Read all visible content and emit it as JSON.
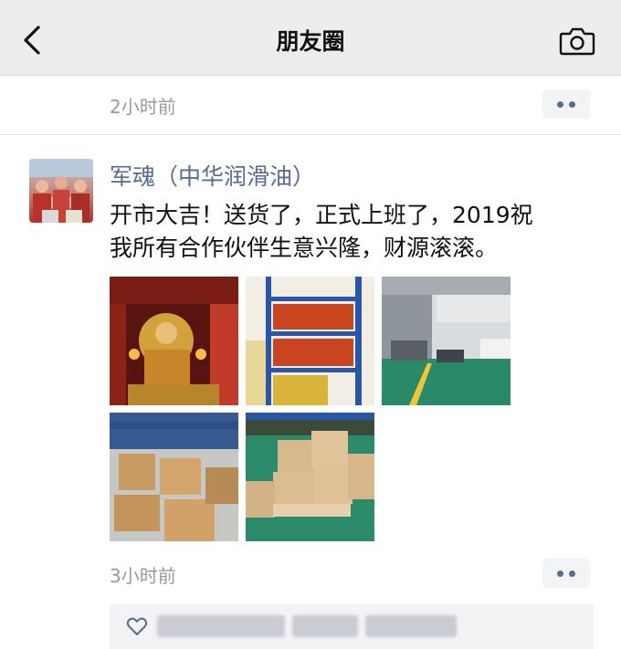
{
  "nav": {
    "title": "朋友圈",
    "back_icon": "chevron-left-icon",
    "camera_icon": "camera-icon"
  },
  "prev_post": {
    "time": "2小时前"
  },
  "post": {
    "username": "军魂（中华润滑油）",
    "text": "开市大吉！送货了，正式上班了，2019祝\n我所有合作伙伴生意兴隆，财源滚滚。",
    "photos": [
      {
        "desc": "shrine-photo"
      },
      {
        "desc": "oil-shelf-photo"
      },
      {
        "desc": "garage-photo"
      },
      {
        "desc": "warehouse-boxes-photo"
      },
      {
        "desc": "stacked-boxes-photo"
      }
    ],
    "time": "3小时前",
    "like_icon": "heart-icon"
  },
  "colors": {
    "link": "#576b95",
    "nav_bg": "#ededed",
    "meta": "#9a9a9a"
  }
}
